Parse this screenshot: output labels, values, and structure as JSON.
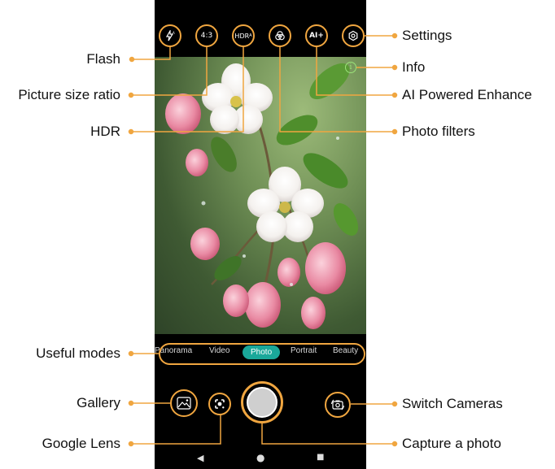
{
  "accent_color": "#f0a640",
  "active_mode_color": "#1aa89a",
  "top_controls": {
    "flash": {
      "icon": "flash-auto-icon"
    },
    "ratio": {
      "label": "4:3"
    },
    "hdr": {
      "label": "HDR",
      "sup": "A"
    },
    "filters": {
      "icon": "filters-icon"
    },
    "ai": {
      "label": "AI+"
    },
    "settings": {
      "icon": "gear-icon"
    }
  },
  "info": {
    "icon": "info-icon",
    "symbol": "i"
  },
  "modes": [
    "Panorama",
    "Video",
    "Photo",
    "Portrait",
    "Beauty"
  ],
  "active_mode": "Photo",
  "bottom_controls": {
    "gallery": {
      "icon": "gallery-icon"
    },
    "lens": {
      "icon": "google-lens-icon"
    },
    "shutter": {
      "icon": "shutter-icon"
    },
    "switch": {
      "icon": "switch-camera-icon"
    }
  },
  "nav": {
    "back": "◀",
    "home": "●",
    "recents": "■"
  },
  "annotations": {
    "left": {
      "flash": "Flash",
      "ratio": "Picture size ratio",
      "hdr": "HDR",
      "modes": "Useful modes",
      "gallery": "Gallery",
      "lens": "Google Lens"
    },
    "right": {
      "settings": "Settings",
      "info": "Info",
      "ai": "AI Powered Enhance",
      "filters": "Photo filters",
      "switch": "Switch Cameras",
      "capture": "Capture a photo"
    }
  }
}
